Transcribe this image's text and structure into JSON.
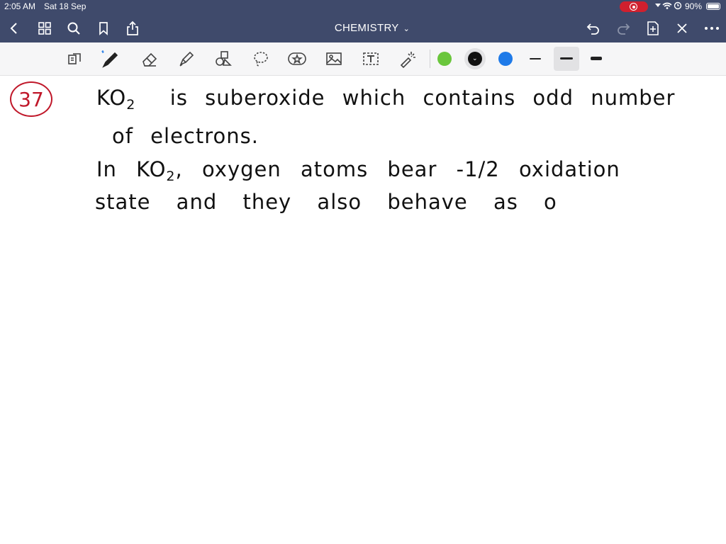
{
  "status_bar": {
    "time": "2:05 AM",
    "date": "Sat 18 Sep",
    "battery": "90%"
  },
  "nav": {
    "title": "CHEMISTRY",
    "title_chevron": "⌄"
  },
  "toolbar": {
    "icons": [
      "page-flip-icon",
      "pen-icon",
      "eraser-icon",
      "highlighter-icon",
      "shapes-icon",
      "lasso-icon",
      "sticker-icon",
      "image-icon",
      "text-icon",
      "laser-icon"
    ],
    "colors": [
      "#6ac63c",
      "#111111",
      "#1e7ae8"
    ],
    "selected_color": "#111111"
  },
  "note": {
    "question_number": "37",
    "lines": {
      "l1_part1": "KO",
      "l1_sub": "2",
      "l1_part2": "is  suberoxide  which  contains  odd  number",
      "l2": "of  electrons.",
      "l3_part1": "In  KO",
      "l3_sub": "2",
      "l3_part2": ",  oxygen  atoms  bear  -1/2  oxidation",
      "l4": "state  and  they  also  behave  as  o"
    }
  }
}
